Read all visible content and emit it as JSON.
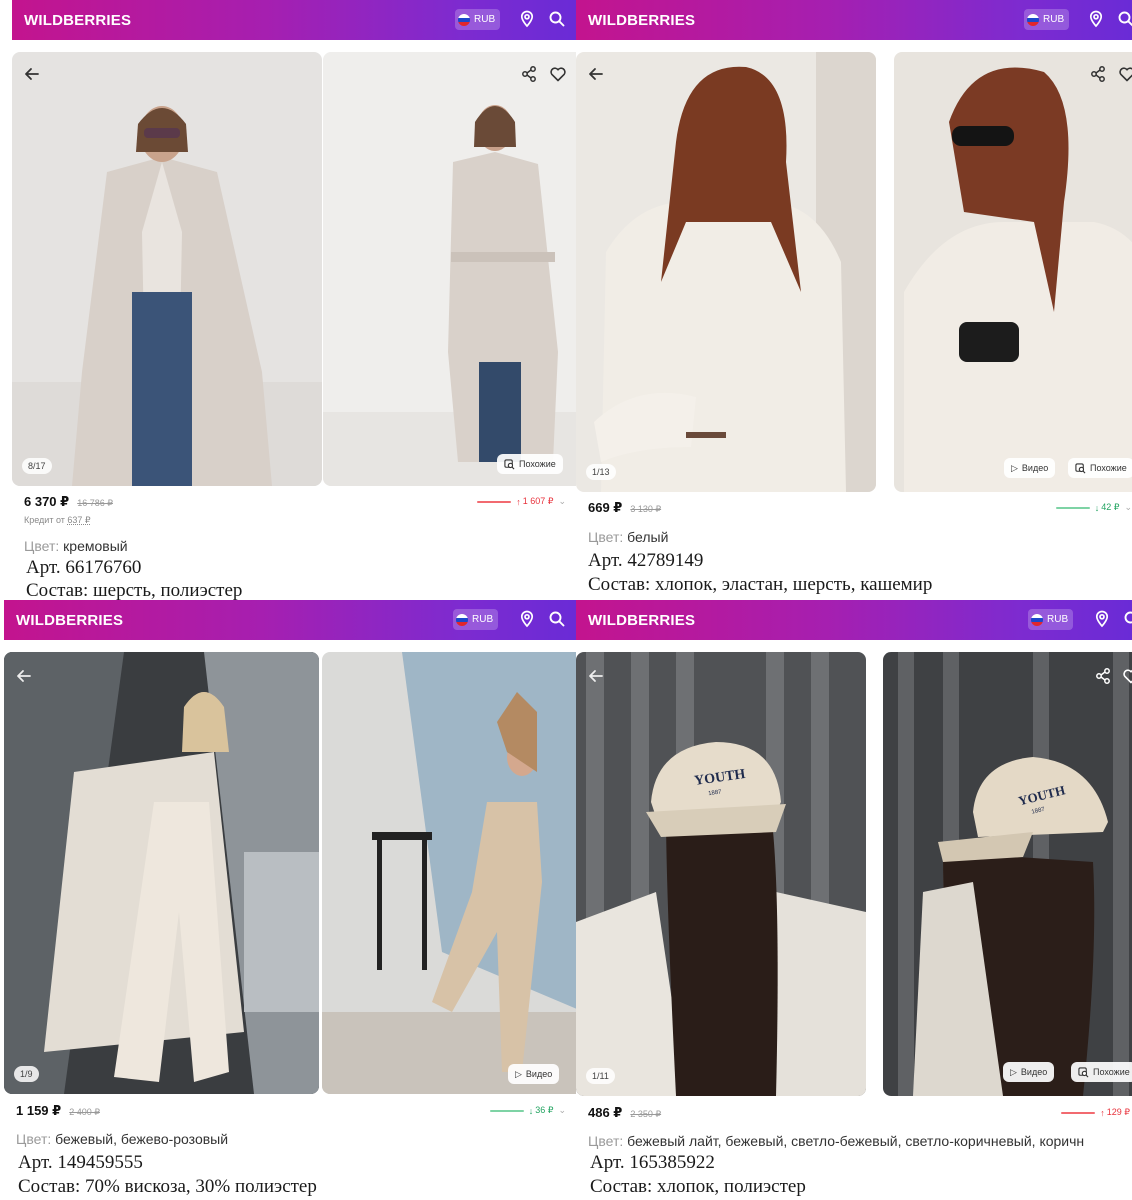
{
  "panels": [
    {
      "logo": "WILDBERRIES",
      "currency": "RUB",
      "counter": "8/17",
      "similar_label": "Похожие",
      "video_label": "",
      "price": "6 370 ₽",
      "old_price": "16 786 ₽",
      "credit_label": "Кредит от",
      "credit_value": "637 ₽",
      "trend": {
        "direction": "up",
        "arrow": "↑",
        "value": "1 607 ₽"
      },
      "color_label": "Цвет:",
      "color_value": "кремовый",
      "article": "Арт. 66176760",
      "composition": "Состав: шерсть, полиэстер"
    },
    {
      "logo": "WILDBERRIES",
      "currency": "RUB",
      "counter": "1/13",
      "similar_label": "Похожие",
      "video_label": "Видео",
      "price": "669 ₽",
      "old_price": "3 130 ₽",
      "trend": {
        "direction": "down",
        "arrow": "↓",
        "value": "42 ₽"
      },
      "color_label": "Цвет:",
      "color_value": "белый",
      "article": "Арт. 42789149",
      "composition": "Состав: хлопок, эластан, шерсть, кашемир"
    },
    {
      "logo": "WILDBERRIES",
      "currency": "RUB",
      "counter": "1/9",
      "similar_label": "",
      "video_label": "Видео",
      "price": "1 159 ₽",
      "old_price": "2 400 ₽",
      "trend": {
        "direction": "down",
        "arrow": "↓",
        "value": "36 ₽"
      },
      "color_label": "Цвет:",
      "color_value": "бежевый, бежево-розовый",
      "article": "Арт. 149459555",
      "composition": "Состав: 70% вискоза, 30% полиэстер"
    },
    {
      "logo": "WILDBERRIES",
      "currency": "RUB",
      "counter": "1/11",
      "similar_label": "Похожие",
      "video_label": "Видео",
      "price": "486 ₽",
      "old_price": "2 350 ₽",
      "trend": {
        "direction": "up",
        "arrow": "↑",
        "value": "129 ₽"
      },
      "color_label": "Цвет:",
      "color_value": "бежевый лайт, бежевый, светло-бежевый, светло-коричневый, коричн",
      "article": "Арт. 165385922",
      "composition": "Состав: хлопок, полиэстер"
    }
  ],
  "photos": [
    {
      "subject": "woman in long cream wool coat, jeans, sunglasses",
      "tones": [
        "#e6e4e2",
        "#d9d2cc"
      ]
    },
    {
      "subject": "woman in belted cream coat, jeans",
      "tones": [
        "#efeeec",
        "#ddd6d0"
      ]
    },
    {
      "subject": "red-haired woman in white turtleneck sweater",
      "tones": [
        "#ece9e4",
        "#d5c9bc"
      ]
    },
    {
      "subject": "red-haired woman in white sweater with sunglasses",
      "tones": [
        "#e9e5df",
        "#d2c4b5"
      ]
    },
    {
      "subject": "woman in beige wide trousers and long coat",
      "tones": [
        "#3c3f42",
        "#8a8580"
      ]
    },
    {
      "subject": "woman in beige top and trousers posing by window",
      "tones": [
        "#dcdcda",
        "#b6ada2"
      ]
    },
    {
      "subject": "woman in beige YOUTH 1887 cap and white coat",
      "tones": [
        "#515356",
        "#c9c4bb"
      ]
    },
    {
      "subject": "woman in beige YOUTH 1887 cap, side view",
      "tones": [
        "#3f4144",
        "#a7a29b"
      ]
    }
  ],
  "cap_text": {
    "brand": "YOUTH",
    "year": "1887"
  },
  "colors": {
    "accent_start": "#c3148e",
    "accent_end": "#6a2bd6",
    "up": "#e8323c",
    "down": "#23a461"
  }
}
